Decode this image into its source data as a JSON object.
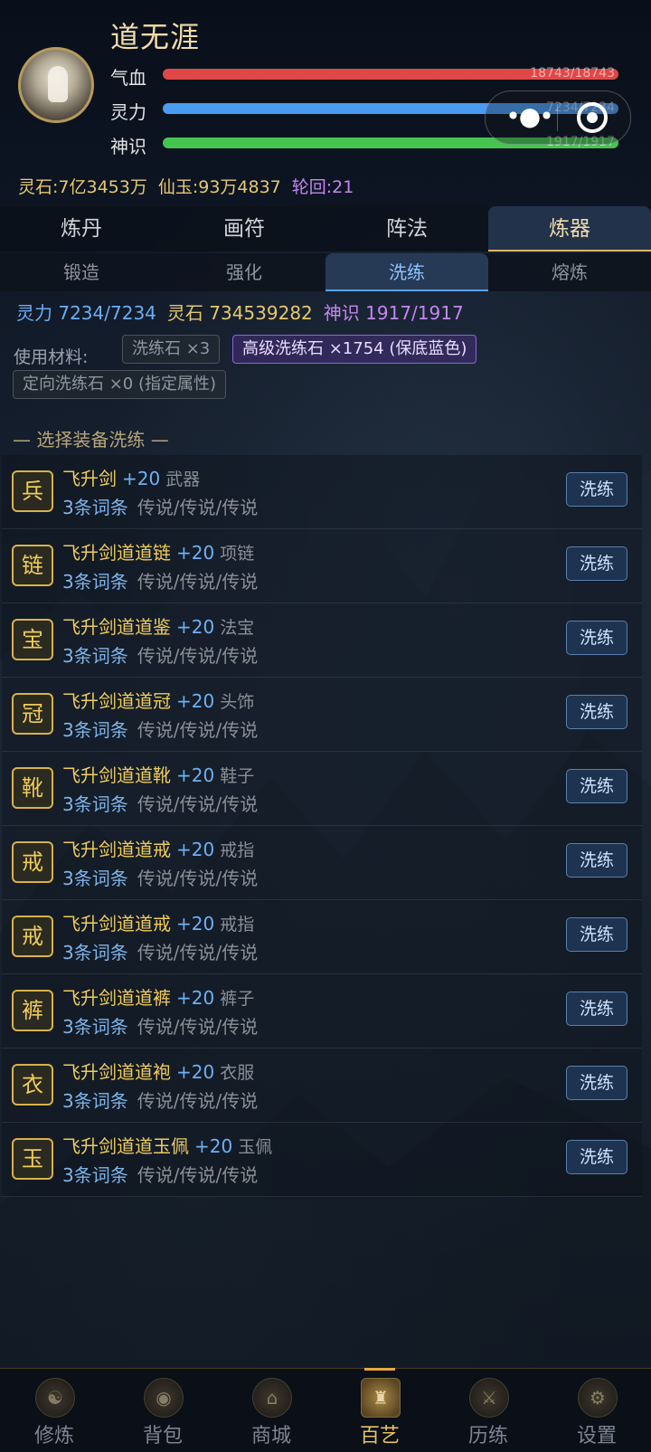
{
  "player": {
    "name": "道无涯",
    "hp_label": "气血",
    "hp_value": "18743/18743",
    "mp_label": "灵力",
    "mp_value": "7234/7234",
    "sp_label": "神识",
    "sp_value": "1917/1917"
  },
  "currency": {
    "stone": "灵石:7亿3453万",
    "jade": "仙玉:93万4837",
    "cycle": "轮回:21"
  },
  "tabs": [
    {
      "label": "炼丹"
    },
    {
      "label": "画符"
    },
    {
      "label": "阵法"
    },
    {
      "label": "炼器"
    }
  ],
  "subtabs": [
    {
      "label": "锻造"
    },
    {
      "label": "强化"
    },
    {
      "label": "洗练"
    },
    {
      "label": "熔炼"
    }
  ],
  "resources": {
    "mp": "灵力 7234/7234",
    "stone": "灵石 734539282",
    "sp": "神识 1917/1917"
  },
  "materials": {
    "label": "使用材料:",
    "items": [
      {
        "label": "洗练石 ×3"
      },
      {
        "label": "高级洗练石 ×1754 (保底蓝色)"
      },
      {
        "label": "定向洗练石 ×0 (指定属性)"
      }
    ]
  },
  "section_title": "— 选择装备洗练 —",
  "equipment": [
    {
      "slot": "兵",
      "name": "飞升剑",
      "level": "+20",
      "type": "武器",
      "affix_count": "3条词条",
      "affix_quality": "传说/传说/传说",
      "button": "洗练"
    },
    {
      "slot": "链",
      "name": "飞升剑道道链",
      "level": "+20",
      "type": "项链",
      "affix_count": "3条词条",
      "affix_quality": "传说/传说/传说",
      "button": "洗练"
    },
    {
      "slot": "宝",
      "name": "飞升剑道道鉴",
      "level": "+20",
      "type": "法宝",
      "affix_count": "3条词条",
      "affix_quality": "传说/传说/传说",
      "button": "洗练"
    },
    {
      "slot": "冠",
      "name": "飞升剑道道冠",
      "level": "+20",
      "type": "头饰",
      "affix_count": "3条词条",
      "affix_quality": "传说/传说/传说",
      "button": "洗练"
    },
    {
      "slot": "靴",
      "name": "飞升剑道道靴",
      "level": "+20",
      "type": "鞋子",
      "affix_count": "3条词条",
      "affix_quality": "传说/传说/传说",
      "button": "洗练"
    },
    {
      "slot": "戒",
      "name": "飞升剑道道戒",
      "level": "+20",
      "type": "戒指",
      "affix_count": "3条词条",
      "affix_quality": "传说/传说/传说",
      "button": "洗练"
    },
    {
      "slot": "戒",
      "name": "飞升剑道道戒",
      "level": "+20",
      "type": "戒指",
      "affix_count": "3条词条",
      "affix_quality": "传说/传说/传说",
      "button": "洗练"
    },
    {
      "slot": "裤",
      "name": "飞升剑道道裤",
      "level": "+20",
      "type": "裤子",
      "affix_count": "3条词条",
      "affix_quality": "传说/传说/传说",
      "button": "洗练"
    },
    {
      "slot": "衣",
      "name": "飞升剑道道袍",
      "level": "+20",
      "type": "衣服",
      "affix_count": "3条词条",
      "affix_quality": "传说/传说/传说",
      "button": "洗练"
    },
    {
      "slot": "玉",
      "name": "飞升剑道道玉佩",
      "level": "+20",
      "type": "玉佩",
      "affix_count": "3条词条",
      "affix_quality": "传说/传说/传说",
      "button": "洗练"
    }
  ],
  "bottom_nav": [
    {
      "label": "修炼",
      "icon": "cultivate-icon"
    },
    {
      "label": "背包",
      "icon": "bag-icon"
    },
    {
      "label": "商城",
      "icon": "shop-icon"
    },
    {
      "label": "百艺",
      "icon": "crafts-icon"
    },
    {
      "label": "历练",
      "icon": "adventure-icon"
    },
    {
      "label": "设置",
      "icon": "settings-icon"
    }
  ]
}
